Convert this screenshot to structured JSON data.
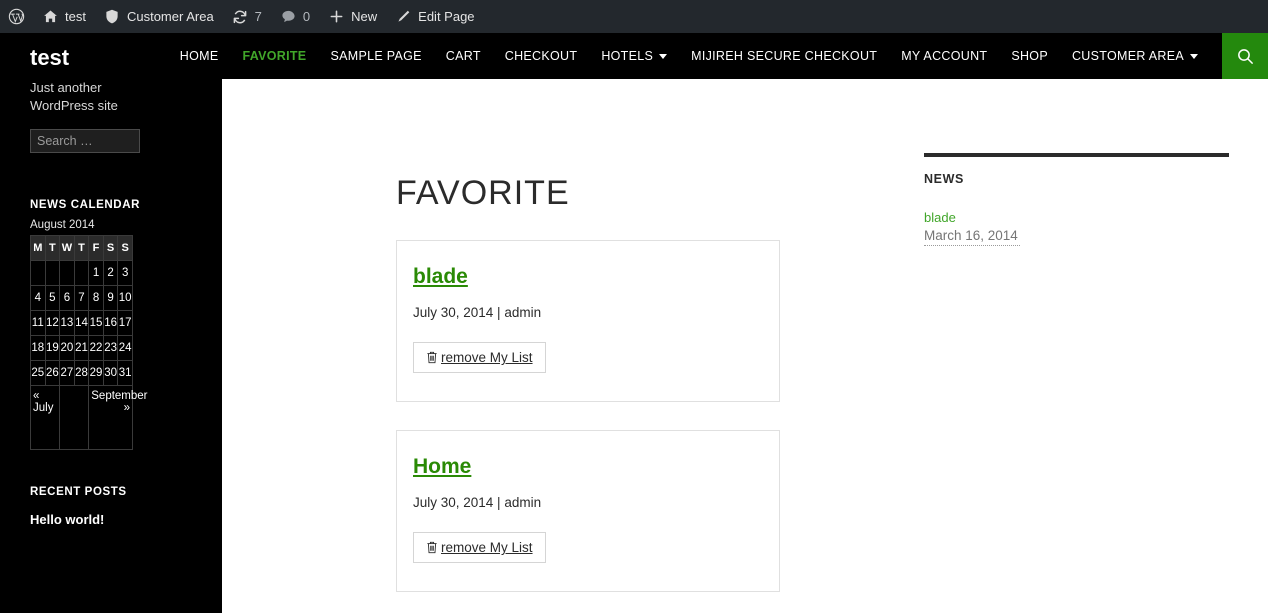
{
  "adminbar": {
    "logo_icon": "wordpress-logo-icon",
    "items": [
      {
        "icon": "home-icon",
        "label": "test"
      },
      {
        "icon": "shield-icon",
        "label": "Customer Area"
      },
      {
        "icon": "updates-icon",
        "label": "7"
      },
      {
        "icon": "comment-icon",
        "label": "0"
      },
      {
        "icon": "plus-icon",
        "label": "New"
      },
      {
        "icon": "pencil-icon",
        "label": "Edit Page"
      }
    ]
  },
  "sidebar": {
    "site_title": "test",
    "site_description": "Just another WordPress site",
    "search": {
      "placeholder": "Search …",
      "value": ""
    },
    "calendar": {
      "widget_title": "News Calendar",
      "caption": "August 2014",
      "weekdays": [
        "M",
        "T",
        "W",
        "T",
        "F",
        "S",
        "S"
      ],
      "weeks": [
        [
          "",
          "",
          "",
          "",
          "1",
          "2",
          "3"
        ],
        [
          "4",
          "5",
          "6",
          "7",
          "8",
          "9",
          "10"
        ],
        [
          "11",
          "12",
          "13",
          "14",
          "15",
          "16",
          "17"
        ],
        [
          "18",
          "19",
          "20",
          "21",
          "22",
          "23",
          "24"
        ],
        [
          "25",
          "26",
          "27",
          "28",
          "29",
          "30",
          "31"
        ]
      ],
      "prev_label": "« July",
      "next_label": "September »"
    },
    "recent": {
      "widget_title": "Recent Posts",
      "items": [
        {
          "label": "Hello world!"
        }
      ]
    }
  },
  "nav": {
    "items": [
      {
        "label": "Home",
        "current": false,
        "has_dropdown": false
      },
      {
        "label": "Favorite",
        "current": true,
        "has_dropdown": false
      },
      {
        "label": "Sample Page",
        "current": false,
        "has_dropdown": false
      },
      {
        "label": "Cart",
        "current": false,
        "has_dropdown": false
      },
      {
        "label": "Checkout",
        "current": false,
        "has_dropdown": false
      },
      {
        "label": "Hotels",
        "current": false,
        "has_dropdown": true
      },
      {
        "label": "Mijireh Secure Checkout",
        "current": false,
        "has_dropdown": false
      },
      {
        "label": "My Account",
        "current": false,
        "has_dropdown": false
      },
      {
        "label": "Shop",
        "current": false,
        "has_dropdown": false
      },
      {
        "label": "Customer Area",
        "current": false,
        "has_dropdown": true
      }
    ],
    "search_icon": "search-icon",
    "search_button_color": "#24890d"
  },
  "main": {
    "page_title": "FAVORITE",
    "cards": [
      {
        "title": "blade",
        "meta": "July 30, 2014 | admin",
        "button_label": "remove My List",
        "button_icon": "trash-icon"
      },
      {
        "title": "Home",
        "meta": "July 30, 2014 | admin",
        "button_label": "remove My List",
        "button_icon": "trash-icon"
      }
    ]
  },
  "news_widget": {
    "title": "NEWS",
    "items": [
      {
        "link": "blade",
        "date": "March 16, 2014"
      }
    ]
  },
  "colors": {
    "accent_green": "#24890d",
    "link_green": "#2a8a05",
    "nav_current": "#41a62a",
    "adminbar_bg": "#23282d",
    "sidebar_bg": "#000000"
  }
}
